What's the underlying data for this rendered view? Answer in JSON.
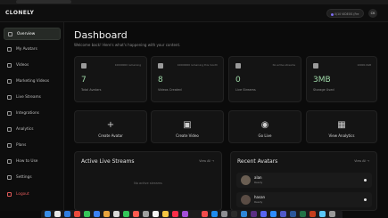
{
  "app": {
    "logo": "CLONELY"
  },
  "header": {
    "credit_label": "0/10 VIDEOS (Fre",
    "user_initials": "CK"
  },
  "sidebar": {
    "items": [
      {
        "label": "Overview",
        "icon": "grid-icon",
        "active": true
      },
      {
        "label": "My Avatars",
        "icon": "user-icon",
        "active": false
      },
      {
        "label": "Videos",
        "icon": "video-icon",
        "active": false
      },
      {
        "label": "Marketing Videos",
        "icon": "megaphone-icon",
        "active": false
      },
      {
        "label": "Live Streams",
        "icon": "broadcast-icon",
        "active": false
      },
      {
        "label": "Integrations",
        "icon": "plug-icon",
        "active": false
      },
      {
        "label": "Analytics",
        "icon": "chart-icon",
        "active": false
      },
      {
        "label": "Plans",
        "icon": "card-icon",
        "active": false
      },
      {
        "label": "How to Use",
        "icon": "help-icon",
        "active": false
      },
      {
        "label": "Settings",
        "icon": "gear-icon",
        "active": false
      },
      {
        "label": "Logout",
        "icon": "logout-icon",
        "active": false
      }
    ]
  },
  "dashboard": {
    "title": "Dashboard",
    "subtitle": "Welcome back! Here's what's happening with your content."
  },
  "stats": [
    {
      "icon": "avatar-icon",
      "meta": "10000000 remaining",
      "value": "7",
      "label": "Total Avatars"
    },
    {
      "icon": "clapper-icon",
      "meta": "10000000 remaining this month",
      "value": "8",
      "label": "Videos Created"
    },
    {
      "icon": "satellite-icon",
      "meta": "No active streams",
      "value": "0",
      "label": "Live Streams"
    },
    {
      "icon": "disk-icon",
      "meta": "10000.0GB",
      "value": "3MB",
      "label": "Storage Used"
    }
  ],
  "actions": [
    {
      "icon": "plus-icon",
      "label": "Create Avatar"
    },
    {
      "icon": "clapper-icon",
      "label": "Create Video"
    },
    {
      "icon": "satellite-icon",
      "label": "Go Live"
    },
    {
      "icon": "chart-icon",
      "label": "View Analytics"
    }
  ],
  "live_streams": {
    "title": "Active Live Streams",
    "view_all": "View All",
    "empty_text": "No active streams"
  },
  "recent_avatars": {
    "title": "Recent Avatars",
    "view_all": "View All",
    "items": [
      {
        "name": "alan",
        "sub": "Ready"
      },
      {
        "name": "hasan",
        "sub": "Ready"
      }
    ]
  },
  "colors": {
    "accent_green": "#9fd8a8",
    "logout_red": "#e05a5a",
    "background": "#0b0b0b"
  },
  "dock": {
    "icons": [
      "finder",
      "launchpad",
      "safari",
      "chrome",
      "messages",
      "mail",
      "maps",
      "photos",
      "facetime",
      "calendar",
      "contacts",
      "reminders",
      "notes",
      "music",
      "podcasts",
      "tv",
      "news",
      "app-store",
      "settings",
      "terminal",
      "vscode",
      "slack",
      "discord",
      "zoom",
      "teams",
      "word",
      "excel",
      "powerpoint",
      "preview",
      "trash"
    ]
  }
}
